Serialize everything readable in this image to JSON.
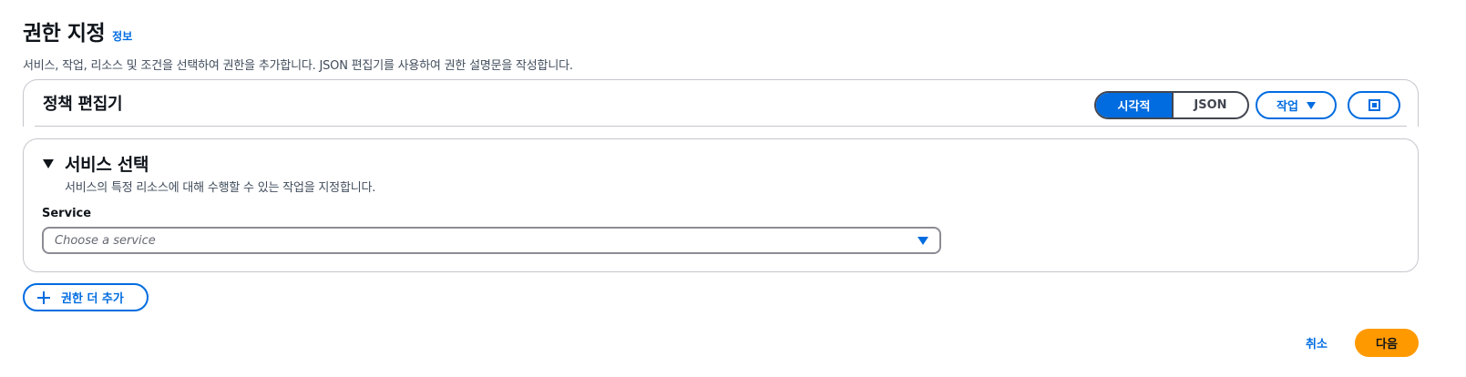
{
  "header": {
    "title": "권한 지정",
    "info_link": "정보",
    "description": "서비스, 작업, 리소스 및 조건을 선택하여 권한을 추가합니다. JSON 편집기를 사용하여 권한 설명문을 작성합니다."
  },
  "policy_editor": {
    "title": "정책 편집기",
    "mode_toggle": [
      {
        "label": "시각적",
        "selected": true
      },
      {
        "label": "JSON",
        "selected": false
      }
    ],
    "actions_label": "작업",
    "actions_icon": "caret-down-icon",
    "fullscreen_icon": "fullscreen-icon"
  },
  "service_section": {
    "title": "서비스 선택",
    "description": "서비스의 특정 리소스에 대해 수행할 수 있는 작업을 지정합니다.",
    "field_label": "Service",
    "select_placeholder": "Choose a service"
  },
  "add_permissions_label": "권한 더 추가",
  "footer": {
    "cancel_label": "취소",
    "next_label": "다음"
  },
  "colors": {
    "accent": "#006ce0",
    "primary_button": "#ff9900",
    "border": "#c6c6cd",
    "text": "#0f141a"
  }
}
